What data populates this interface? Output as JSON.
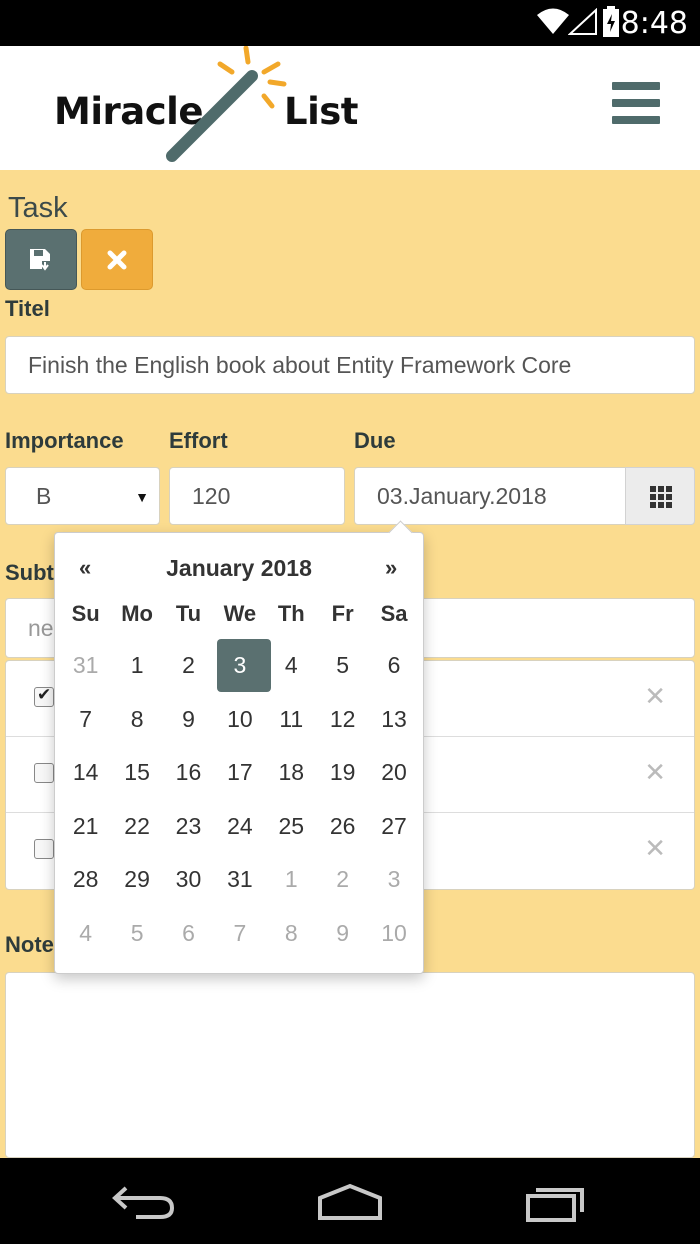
{
  "status_bar": {
    "time": "8:48"
  },
  "header": {
    "logo_word_1": "Miracle",
    "logo_word_2": "List"
  },
  "task": {
    "heading": "Task",
    "title_label": "Titel",
    "title_value": "Finish the English book about Entity Framework Core",
    "importance_label": "Importance",
    "importance_value": "B",
    "effort_label": "Effort",
    "effort_value": "120",
    "due_label": "Due",
    "due_value": "03.January.2018",
    "subtasks_label": "Subt",
    "subtask_placeholder": "ne",
    "subtasks": [
      {
        "checked": true
      },
      {
        "checked": false
      },
      {
        "checked": false
      }
    ],
    "notes_label": "Note"
  },
  "datepicker": {
    "prev": "«",
    "next": "»",
    "title": "January 2018",
    "weekdays": [
      "Su",
      "Mo",
      "Tu",
      "We",
      "Th",
      "Fr",
      "Sa"
    ],
    "weeks": [
      [
        "31",
        "1",
        "2",
        "3",
        "4",
        "5",
        "6"
      ],
      [
        "7",
        "8",
        "9",
        "10",
        "11",
        "12",
        "13"
      ],
      [
        "14",
        "15",
        "16",
        "17",
        "18",
        "19",
        "20"
      ],
      [
        "21",
        "22",
        "23",
        "24",
        "25",
        "26",
        "27"
      ],
      [
        "28",
        "29",
        "30",
        "31",
        "1",
        "2",
        "3"
      ],
      [
        "4",
        "5",
        "6",
        "7",
        "8",
        "9",
        "10"
      ]
    ],
    "selected": "3"
  },
  "colors": {
    "background": "#fbdc8f",
    "primary": "#5a7070",
    "accent": "#f0ac3c"
  },
  "icons": {
    "save": "save-icon",
    "cancel": "close-icon",
    "calendar": "calendar-grid-icon",
    "menu": "hamburger-menu-icon"
  }
}
